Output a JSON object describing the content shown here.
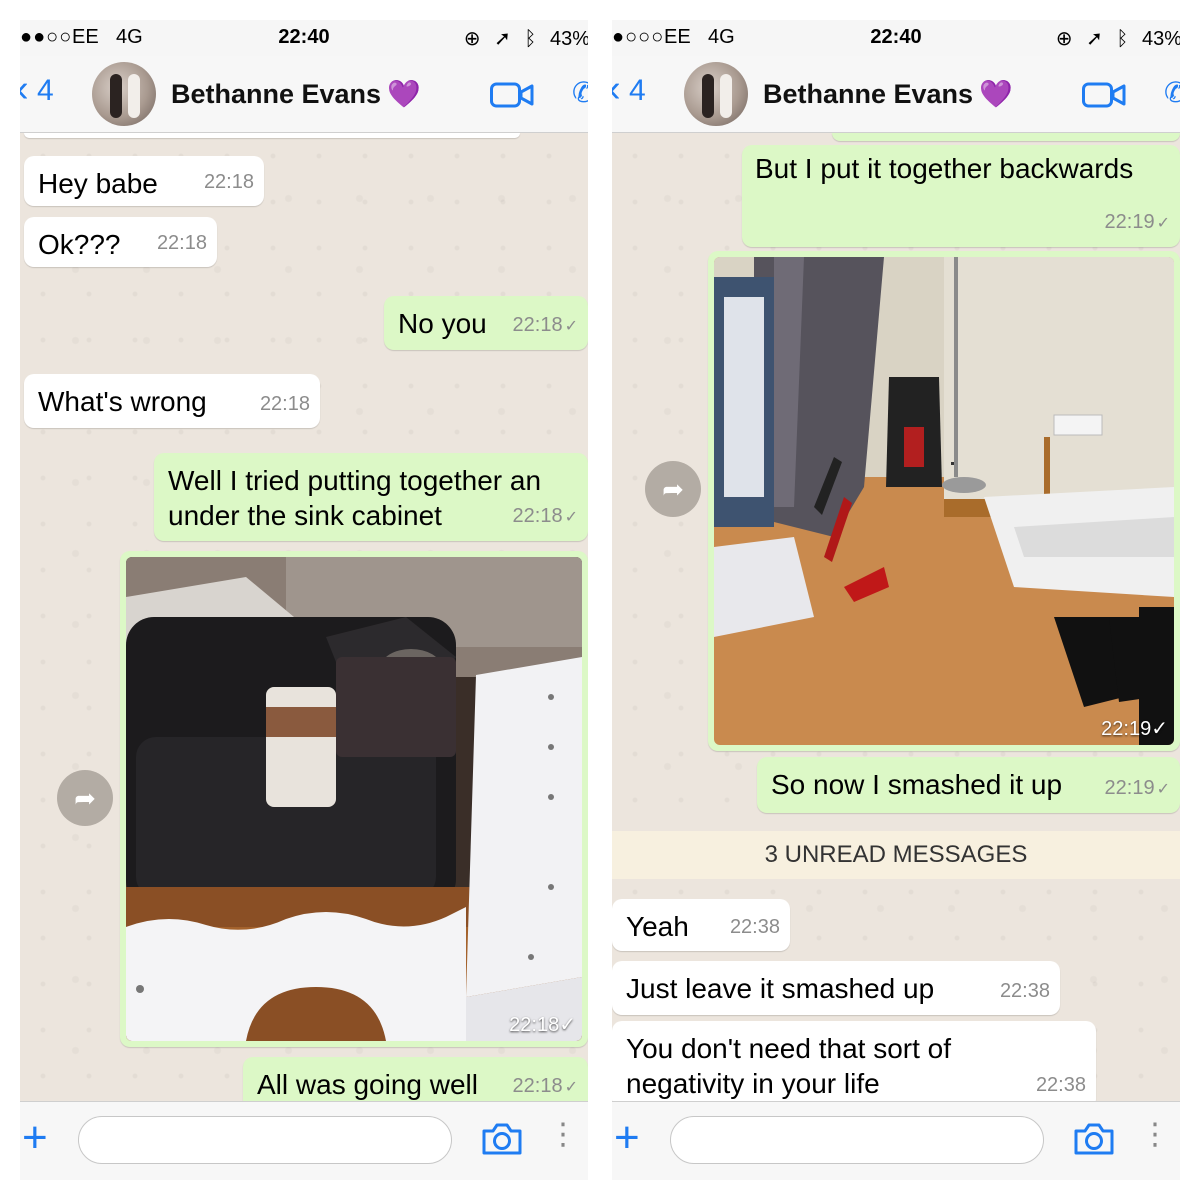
{
  "status": {
    "signal": "●●○○",
    "signal_right": "●○○○",
    "carrier": "EE",
    "network": "4G",
    "time": "22:40",
    "battery": "43%",
    "icons": [
      "orientation-lock-icon",
      "location-arrow-icon",
      "bluetooth-icon"
    ]
  },
  "chat": {
    "back_count": "4",
    "contact_name": "Bethanne Evans",
    "contact_emoji": "💜"
  },
  "left_messages": [
    {
      "text": "Hey babe",
      "time": "22:18",
      "dir": "in"
    },
    {
      "text": "Ok???",
      "time": "22:18",
      "dir": "in"
    },
    {
      "text": "No you",
      "time": "22:18",
      "dir": "out"
    },
    {
      "text": "What's wrong",
      "time": "22:18",
      "dir": "in"
    },
    {
      "text": "Well I tried putting together an under the sink cabinet",
      "time": "22:18",
      "dir": "out"
    },
    {
      "photo": "cabinet-parts-on-sofa",
      "time": "22:18",
      "dir": "out"
    },
    {
      "text": "All was going well",
      "time": "22:18",
      "dir": "out"
    }
  ],
  "right_messages": [
    {
      "text": "But I put it together backwards",
      "time": "22:19",
      "dir": "out"
    },
    {
      "photo": "smashed-cabinet-on-floor",
      "time": "22:19",
      "dir": "out"
    },
    {
      "text": "So now I smashed it up",
      "time": "22:19",
      "dir": "out"
    },
    {
      "text": "Yeah",
      "time": "22:38",
      "dir": "in"
    },
    {
      "text": "Just leave it smashed up",
      "time": "22:38",
      "dir": "in"
    },
    {
      "text": "You don't need that sort of negativity in your life",
      "time": "22:38",
      "dir": "in"
    }
  ],
  "unread_label": "3 UNREAD MESSAGES",
  "colors": {
    "accent": "#1f7cf2",
    "outgoing_bubble": "#dcf8c6",
    "incoming_bubble": "#ffffff",
    "chat_background": "#ece5dd",
    "heart": "#9b3bd4"
  }
}
